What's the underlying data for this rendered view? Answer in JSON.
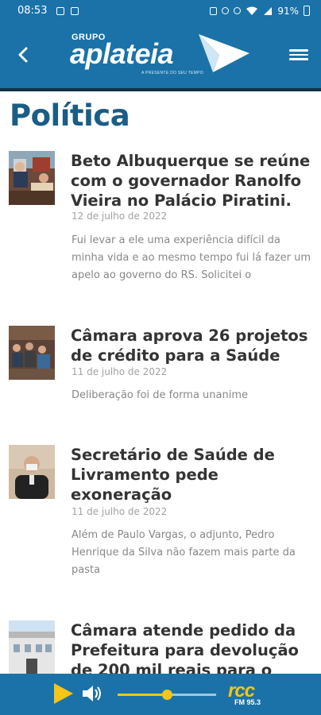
{
  "status_bar": {
    "time": "08:53",
    "battery": "91%"
  },
  "header": {
    "logo_group": "GRUPO",
    "logo_name": "aplateia",
    "logo_tagline": "A PRESENTE DO SEU TEMPO",
    "back_icon": "chevron-left-icon",
    "menu_icon": "hamburger-menu-icon",
    "colors": {
      "bar": "#1a72a8",
      "accent_line": "#0f3346"
    }
  },
  "page": {
    "title": "Política",
    "title_color": "#1a5d86"
  },
  "articles": [
    {
      "title": "Beto Albuquerque se reúne com o governador Ranolfo Vieira no Palácio Piratini.",
      "date": "12 de julho de 2022",
      "excerpt": "Fui levar a ele uma experiência difícil da minha vida e ao mesmo tempo fui lá fazer um apelo ao governo do RS. Solicitei o"
    },
    {
      "title": "Câmara aprova 26 projetos de crédito para a Saúde",
      "date": "11 de julho de 2022",
      "excerpt": "Deliberação foi de forma unanime"
    },
    {
      "title": "Secretário de Saúde de Livramento pede exoneração",
      "date": "11 de julho de 2022",
      "excerpt": "Além de Paulo Vargas, o adjunto, Pedro Henrique da Silva não fazem mais parte da pasta"
    },
    {
      "title": "Câmara atende pedido da Prefeitura para devolução de 200 mil reais para o",
      "date": "",
      "excerpt": ""
    }
  ],
  "player": {
    "play_icon": "play-icon",
    "volume_icon": "volume-icon",
    "volume_level": 0.5,
    "station_logo": "rcc",
    "station_freq": "FM 95.3",
    "accent": "#f5c518"
  }
}
